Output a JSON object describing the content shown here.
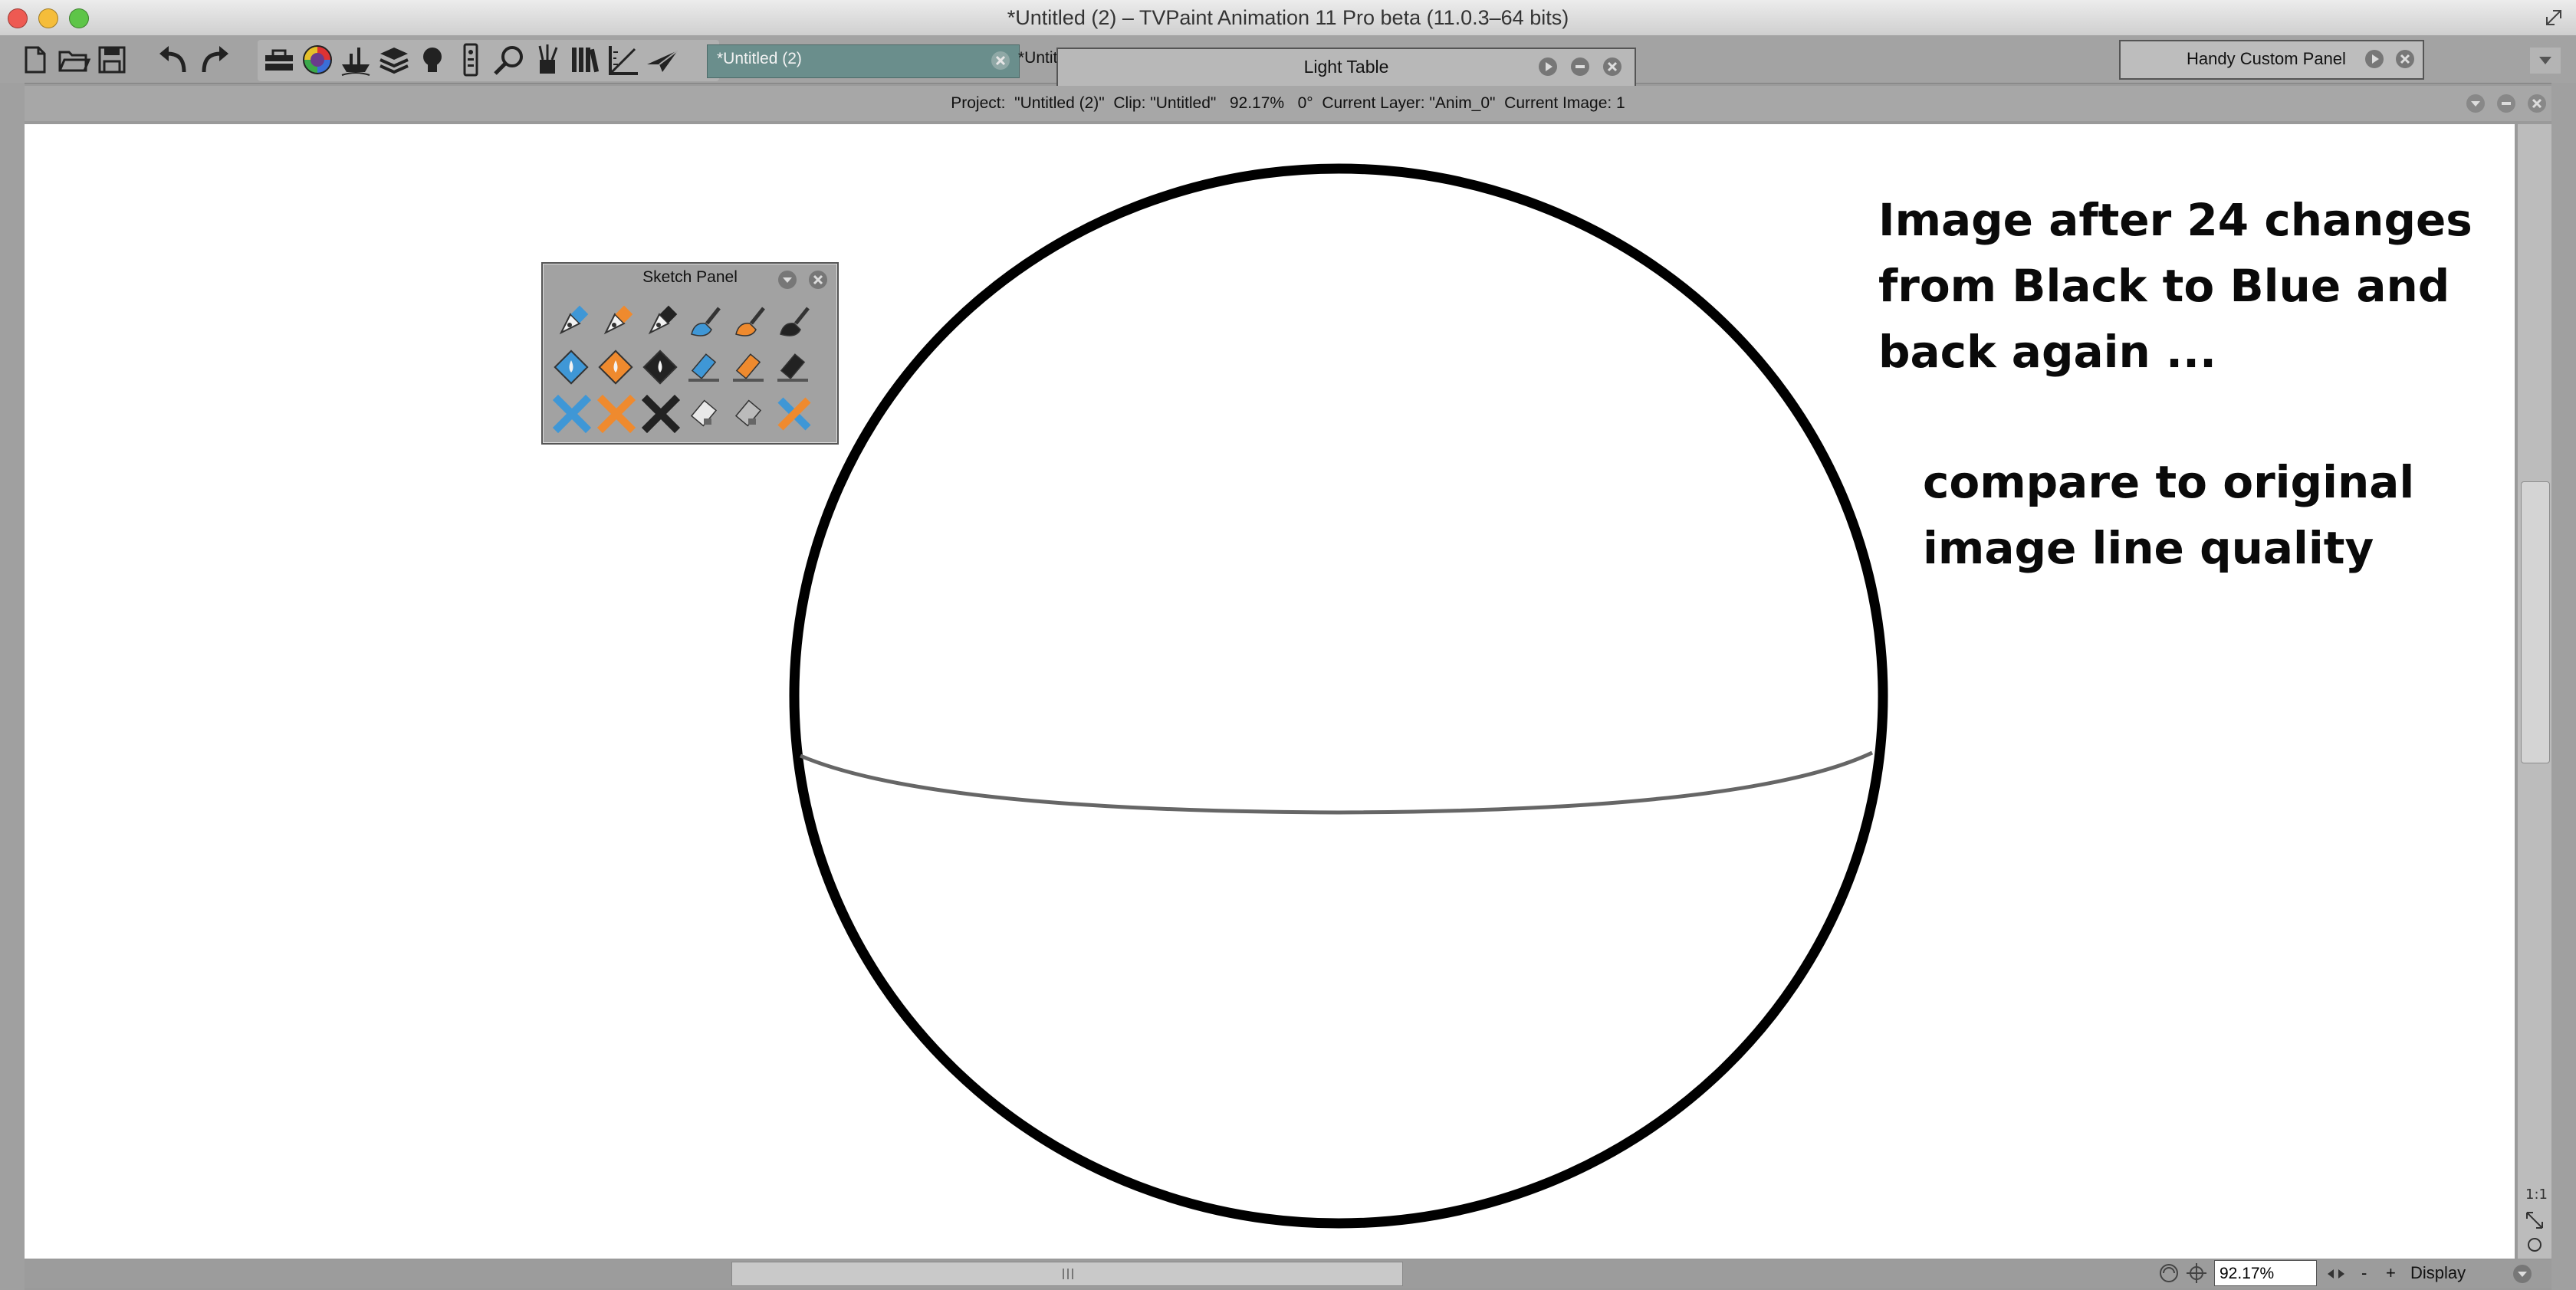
{
  "window": {
    "title": "*Untitled (2) – TVPaint Animation 11 Pro beta (11.0.3–64 bits)"
  },
  "traffic_lights": {
    "close": "#ee5a52",
    "minimize": "#f5bd3a",
    "zoom": "#5ec548"
  },
  "toolbar": {
    "icons": [
      "new-file-icon",
      "open-folder-icon",
      "save-icon",
      "undo-icon",
      "redo-icon",
      "toolbox-icon",
      "color-wheel-icon",
      "ship-icon",
      "layers-icon",
      "lightbulb-icon",
      "remote-icon",
      "magnifier-icon",
      "brushes-icon",
      "library-icon",
      "ruler-icon",
      "paper-plane-icon"
    ],
    "tab_active": "*Untitled (2)",
    "tab_inactive": "*Untitled"
  },
  "light_table": {
    "title": "Light Table"
  },
  "handy_panel": {
    "title": "Handy Custom Panel"
  },
  "info_bar": {
    "text": "Project:  \"Untitled (2)\"  Clip: \"Untitled\"   92.17%   0°  Current Layer: \"Anim_0\"  Current Image: 1"
  },
  "canvas": {
    "note1": [
      "Image after 24 changes",
      "from Black to Blue and",
      "back again ..."
    ],
    "note2": [
      "compare to original",
      "image line quality"
    ]
  },
  "sketch_panel": {
    "title": "Sketch Panel",
    "tools": [
      {
        "name": "blue-pen-icon",
        "color": "#3f97d6"
      },
      {
        "name": "orange-pen-icon",
        "color": "#ef8a2e"
      },
      {
        "name": "black-pen-icon",
        "color": "#222222"
      },
      {
        "name": "blue-brush-icon",
        "color": "#3f97d6"
      },
      {
        "name": "orange-brush-icon",
        "color": "#ef8a2e"
      },
      {
        "name": "black-brush-icon",
        "color": "#222222"
      },
      {
        "name": "blue-fill-icon",
        "color": "#3f97d6"
      },
      {
        "name": "orange-fill-icon",
        "color": "#ef8a2e"
      },
      {
        "name": "black-fill-icon",
        "color": "#222222"
      },
      {
        "name": "blue-eraser-icon",
        "color": "#3f97d6"
      },
      {
        "name": "orange-eraser-icon",
        "color": "#ef8a2e"
      },
      {
        "name": "black-eraser-icon",
        "color": "#222222"
      },
      {
        "name": "blue-clear-icon",
        "color": "#3f97d6"
      },
      {
        "name": "orange-clear-icon",
        "color": "#ef8a2e"
      },
      {
        "name": "black-clear-icon",
        "color": "#222222"
      },
      {
        "name": "white-eraser-icon",
        "color": "#e8e8e8"
      },
      {
        "name": "gray-eraser-icon",
        "color": "#bbbbbb"
      },
      {
        "name": "blue-orange-clear-icon",
        "color": "#3f97d6"
      }
    ]
  },
  "bottom_bar": {
    "zoom": "92.17%",
    "minus": "-",
    "plus": "+",
    "display": "Display"
  }
}
